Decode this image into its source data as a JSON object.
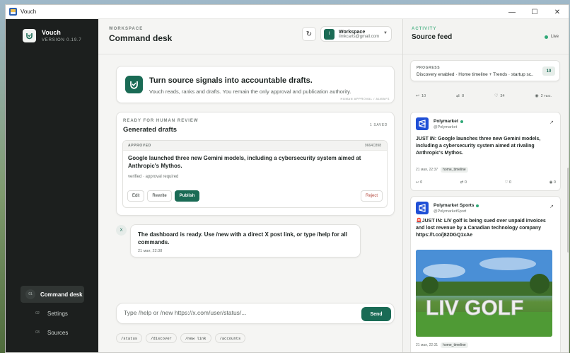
{
  "window": {
    "title": "Vouch"
  },
  "sidebar": {
    "brand_name": "Vouch",
    "version": "VERSION 0.19.7",
    "nav": [
      {
        "num": "01",
        "label": "Command desk",
        "active": true
      },
      {
        "num": "02",
        "label": "Settings",
        "active": false
      },
      {
        "num": "03",
        "label": "Sources",
        "active": false
      }
    ]
  },
  "header": {
    "eyebrow": "WORKSPACE",
    "title": "Command desk",
    "workspace": {
      "initial": "I",
      "name": "Workspace",
      "email": "iimkcarts@gmail.com"
    }
  },
  "intro": {
    "title": "Turn source signals into accountable drafts.",
    "subtitle": "Vouch reads, ranks and drafts. You remain the only approval and publication authority.",
    "tag": "HUMAN APPROVAL / ALWAYS"
  },
  "drafts": {
    "eyebrow": "READY FOR HUMAN REVIEW",
    "title": "Generated drafts",
    "count": "1 SAVED",
    "items": [
      {
        "status": "APPROVED",
        "id": "9664C898",
        "text": "Google launched three new Gemini models, including a cybersecurity system aimed at Anthropic's Mythos.",
        "meta": "verified · approval required",
        "actions": {
          "edit": "Edit",
          "rewrite": "Rewrite",
          "publish": "Publish",
          "reject": "Reject"
        }
      }
    ]
  },
  "message": {
    "avatar": "X",
    "text": "The dashboard is ready. Use /new with a direct X post link, or type /help for all commands.",
    "time": "21 мая, 22:38"
  },
  "composer": {
    "placeholder": "Type /help or /new https://x.com/user/status/...",
    "send_label": "Send",
    "chips": [
      "/status",
      "/discover",
      "/new link",
      "/accounts"
    ]
  },
  "feed": {
    "eyebrow": "ACTIVITY",
    "title": "Source feed",
    "live_label": "Live",
    "progress": {
      "label": "PROGRESS",
      "text": "Discovery enabled · Home timeline + Trends · startup sc...",
      "count": "10"
    },
    "top_stats": {
      "replies": "10",
      "reposts": "8",
      "likes": "34",
      "views": "2 тыс."
    },
    "posts": [
      {
        "name": "Polymarket",
        "handle": "@Polymarket",
        "text": "JUST IN: Google launches three new Gemini models, including a cybersecurity system aimed at rivaling Anthropic's Mythos.",
        "time": "21 мая, 22:37",
        "tag": "home_timeline",
        "stats": {
          "replies": "0",
          "reposts": "0",
          "likes": "0",
          "views": "0"
        }
      },
      {
        "name": "Polymarket Sports",
        "handle": "@PolymarketSport",
        "text": "🚨JUST IN: LIV golf is being sued over unpaid invoices and lost revenue by a Canadian technology company https://t.co/j82DGQ1xAe",
        "time": "21 мая, 22:31",
        "tag": "home_timeline",
        "image_text": "LIV GOLF"
      }
    ]
  },
  "colors": {
    "accent": "#1a6b55",
    "sidebar_bg": "#1c1f1e",
    "polymarket_blue": "#1f4fd6",
    "live_green": "#2fa877",
    "danger": "#b4473b"
  }
}
